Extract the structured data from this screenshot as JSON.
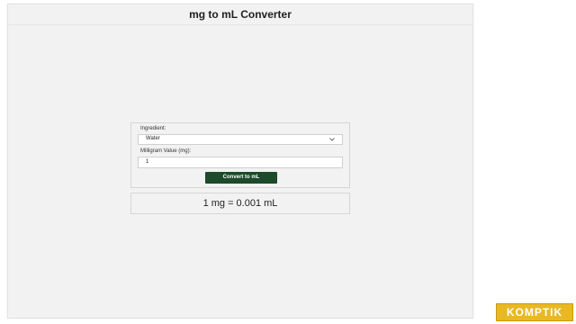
{
  "app": {
    "title": "mg to mL Converter"
  },
  "form": {
    "ingredient_label": "Ingredient:",
    "ingredient_value": "Water",
    "milligram_label": "Milligram Value (mg):",
    "milligram_value": "1",
    "convert_label": "Convert to mL"
  },
  "result": {
    "text": "1 mg = 0.001 mL"
  },
  "brand": {
    "label": "KOMPTIK"
  },
  "colors": {
    "button_bg": "#1c4a2a",
    "badge_bg": "#e8b923"
  }
}
